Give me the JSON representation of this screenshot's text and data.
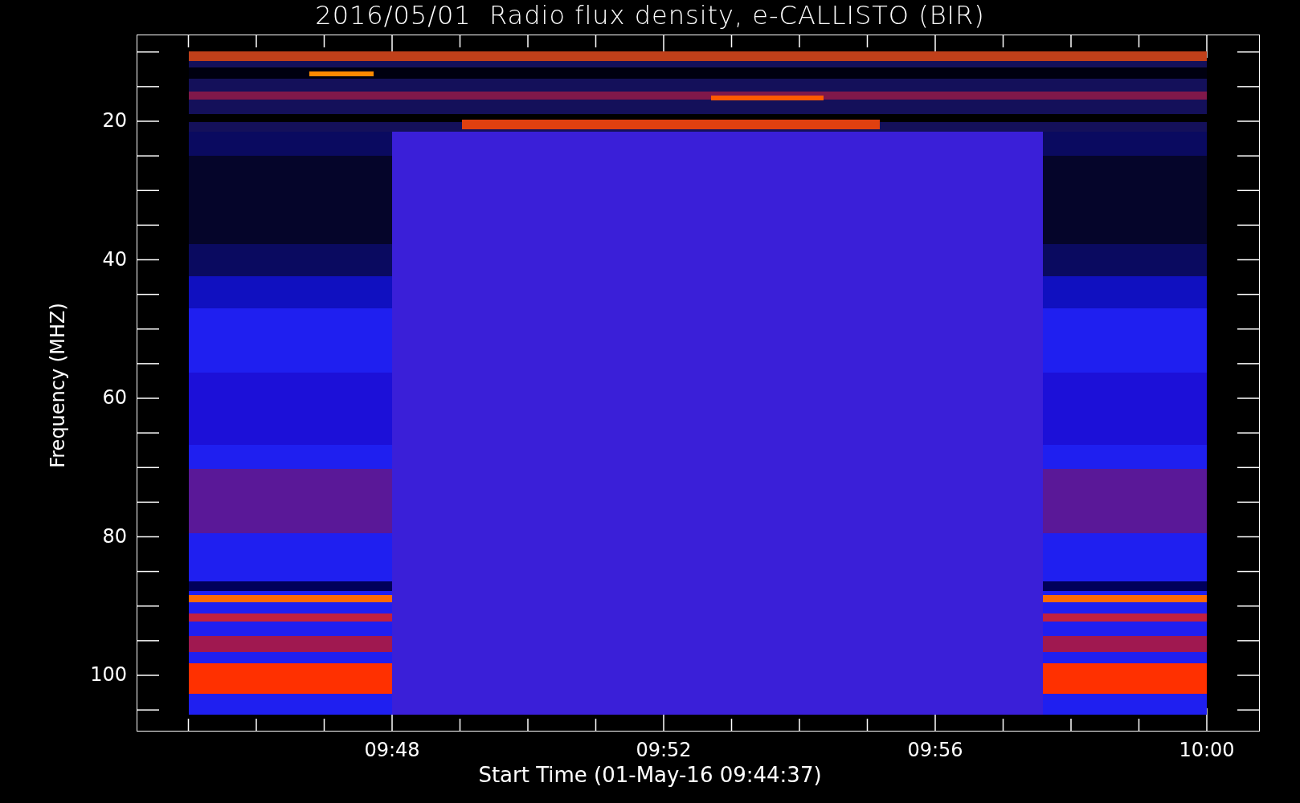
{
  "title": "2016/05/01  Radio flux density, e-CALLISTO (BIR)",
  "y_axis": {
    "label": "Frequency (MHZ)",
    "ticks": [
      "20",
      "40",
      "60",
      "80",
      "100"
    ]
  },
  "x_axis": {
    "label": "Start Time (01-May-16 09:44:37)",
    "ticks": [
      "09:48",
      "09:52",
      "09:56",
      "10:00"
    ]
  }
}
